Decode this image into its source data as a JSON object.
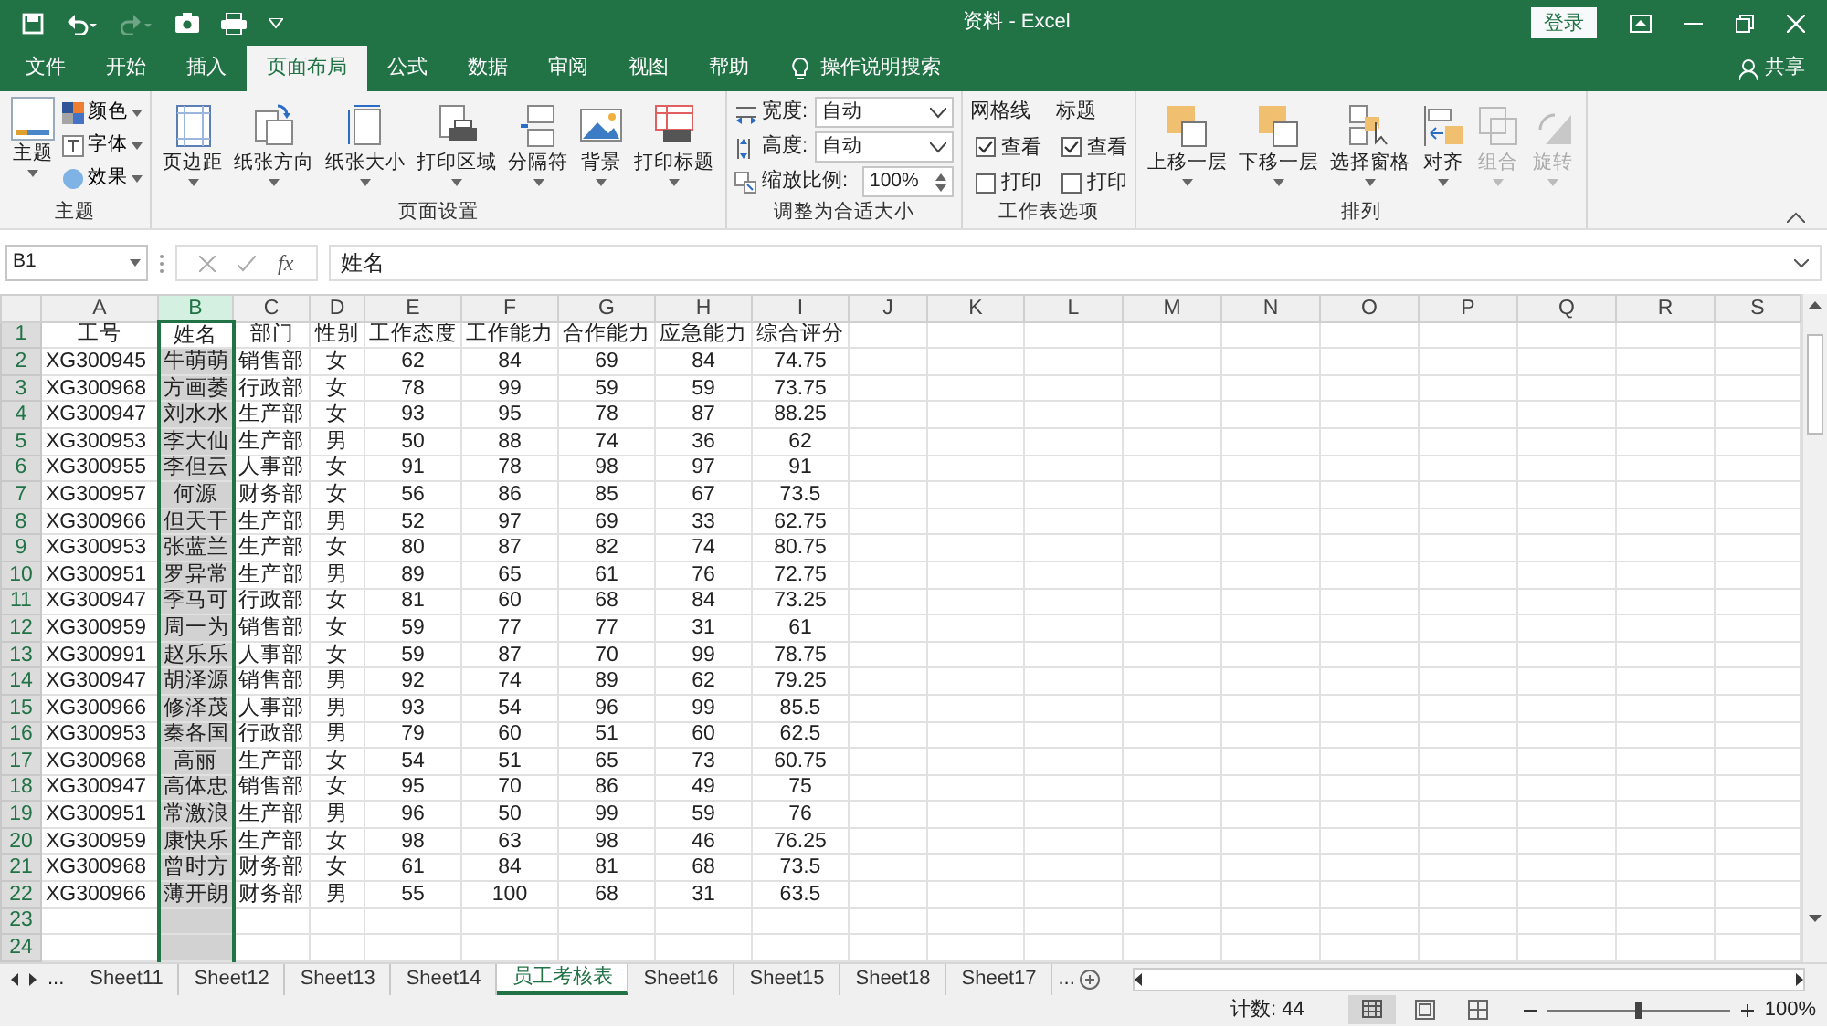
{
  "window": {
    "title": "资料 - Excel"
  },
  "sign_in": "登录",
  "share": "共享",
  "tabs": [
    {
      "label": "文件",
      "selected": false
    },
    {
      "label": "开始",
      "selected": false
    },
    {
      "label": "插入",
      "selected": false
    },
    {
      "label": "页面布局",
      "selected": true
    },
    {
      "label": "公式",
      "selected": false
    },
    {
      "label": "数据",
      "selected": false
    },
    {
      "label": "审阅",
      "selected": false
    },
    {
      "label": "视图",
      "selected": false
    },
    {
      "label": "帮助",
      "selected": false
    }
  ],
  "search": "操作说明搜索",
  "ribbon": {
    "theme": {
      "title": "主题",
      "button": "主题",
      "items": [
        "颜色",
        "字体",
        "效果"
      ]
    },
    "page_setup": {
      "title": "页面设置",
      "buttons": [
        "页边距",
        "纸张方向",
        "纸张大小",
        "打印区域",
        "分隔符",
        "背景",
        "打印标题"
      ]
    },
    "scale_to_fit": {
      "title": "调整为合适大小",
      "fields": [
        {
          "label": "宽度:",
          "value": "自动"
        },
        {
          "label": "高度:",
          "value": "自动"
        },
        {
          "label": "缩放比例:",
          "value": "100%"
        }
      ]
    },
    "sheet_options": {
      "title": "工作表选项",
      "columns": [
        {
          "heading": "网格线",
          "options": [
            {
              "label": "查看",
              "checked": true
            },
            {
              "label": "打印",
              "checked": false
            }
          ]
        },
        {
          "heading": "标题",
          "options": [
            {
              "label": "查看",
              "checked": true
            },
            {
              "label": "打印",
              "checked": false
            }
          ]
        }
      ]
    },
    "arrange": {
      "title": "排列",
      "buttons": [
        {
          "label": "上移一层",
          "disabled": false
        },
        {
          "label": "下移一层",
          "disabled": false
        },
        {
          "label": "选择窗格",
          "disabled": false
        },
        {
          "label": "对齐",
          "disabled": false
        },
        {
          "label": "组合",
          "disabled": true
        },
        {
          "label": "旋转",
          "disabled": true
        }
      ]
    }
  },
  "name_box": "B1",
  "function_button": "fx",
  "formula": "姓名",
  "sheet": {
    "columns": [
      {
        "letter": "A",
        "selected": false
      },
      {
        "letter": "B",
        "selected": true
      },
      {
        "letter": "C",
        "selected": false
      },
      {
        "letter": "D",
        "selected": false
      },
      {
        "letter": "E",
        "selected": false
      },
      {
        "letter": "F",
        "selected": false
      },
      {
        "letter": "G",
        "selected": false
      },
      {
        "letter": "H",
        "selected": false
      },
      {
        "letter": "I",
        "selected": false
      },
      {
        "letter": "J",
        "selected": false
      },
      {
        "letter": "K",
        "selected": false
      },
      {
        "letter": "L",
        "selected": false
      },
      {
        "letter": "M",
        "selected": false
      },
      {
        "letter": "N",
        "selected": false
      },
      {
        "letter": "O",
        "selected": false
      },
      {
        "letter": "P",
        "selected": false
      },
      {
        "letter": "Q",
        "selected": false
      },
      {
        "letter": "R",
        "selected": false
      },
      {
        "letter": "S",
        "selected": false
      }
    ],
    "rows": [
      {
        "number": "1",
        "cells": [
          "工号",
          "姓名",
          "部门",
          "性别",
          "工作态度",
          "工作能力",
          "合作能力",
          "应急能力",
          "综合评分"
        ]
      },
      {
        "number": "2",
        "cells": [
          "XG300945",
          "牛萌萌",
          "销售部",
          "女",
          "62",
          "84",
          "69",
          "84",
          "74.75"
        ]
      },
      {
        "number": "3",
        "cells": [
          "XG300968",
          "方画萎",
          "行政部",
          "女",
          "78",
          "99",
          "59",
          "59",
          "73.75"
        ]
      },
      {
        "number": "4",
        "cells": [
          "XG300947",
          "刘水水",
          "生产部",
          "女",
          "93",
          "95",
          "78",
          "87",
          "88.25"
        ]
      },
      {
        "number": "5",
        "cells": [
          "XG300953",
          "李大仙",
          "生产部",
          "男",
          "50",
          "88",
          "74",
          "36",
          "62"
        ]
      },
      {
        "number": "6",
        "cells": [
          "XG300955",
          "李但云",
          "人事部",
          "女",
          "91",
          "78",
          "98",
          "97",
          "91"
        ]
      },
      {
        "number": "7",
        "cells": [
          "XG300957",
          "何源",
          "财务部",
          "女",
          "56",
          "86",
          "85",
          "67",
          "73.5"
        ]
      },
      {
        "number": "8",
        "cells": [
          "XG300966",
          "但天干",
          "生产部",
          "男",
          "52",
          "97",
          "69",
          "33",
          "62.75"
        ]
      },
      {
        "number": "9",
        "cells": [
          "XG300953",
          "张蓝兰",
          "生产部",
          "女",
          "80",
          "87",
          "82",
          "74",
          "80.75"
        ]
      },
      {
        "number": "10",
        "cells": [
          "XG300951",
          "罗异常",
          "生产部",
          "男",
          "89",
          "65",
          "61",
          "76",
          "72.75"
        ]
      },
      {
        "number": "11",
        "cells": [
          "XG300947",
          "季马可",
          "行政部",
          "女",
          "81",
          "60",
          "68",
          "84",
          "73.25"
        ]
      },
      {
        "number": "12",
        "cells": [
          "XG300959",
          "周一为",
          "销售部",
          "女",
          "59",
          "77",
          "77",
          "31",
          "61"
        ]
      },
      {
        "number": "13",
        "cells": [
          "XG300991",
          "赵乐乐",
          "人事部",
          "女",
          "59",
          "87",
          "70",
          "99",
          "78.75"
        ]
      },
      {
        "number": "14",
        "cells": [
          "XG300947",
          "胡泽源",
          "销售部",
          "男",
          "92",
          "74",
          "89",
          "62",
          "79.25"
        ]
      },
      {
        "number": "15",
        "cells": [
          "XG300966",
          "修泽茂",
          "人事部",
          "男",
          "93",
          "54",
          "96",
          "99",
          "85.5"
        ]
      },
      {
        "number": "16",
        "cells": [
          "XG300953",
          "秦各国",
          "行政部",
          "男",
          "79",
          "60",
          "51",
          "60",
          "62.5"
        ]
      },
      {
        "number": "17",
        "cells": [
          "XG300968",
          "高丽",
          "生产部",
          "女",
          "54",
          "51",
          "65",
          "73",
          "60.75"
        ]
      },
      {
        "number": "18",
        "cells": [
          "XG300947",
          "高体忠",
          "销售部",
          "女",
          "95",
          "70",
          "86",
          "49",
          "75"
        ]
      },
      {
        "number": "19",
        "cells": [
          "XG300951",
          "常激浪",
          "生产部",
          "男",
          "96",
          "50",
          "99",
          "59",
          "76"
        ]
      },
      {
        "number": "20",
        "cells": [
          "XG300959",
          "康快乐",
          "生产部",
          "女",
          "98",
          "63",
          "98",
          "46",
          "76.25"
        ]
      },
      {
        "number": "21",
        "cells": [
          "XG300968",
          "曾时方",
          "财务部",
          "女",
          "61",
          "84",
          "81",
          "68",
          "73.5"
        ]
      },
      {
        "number": "22",
        "cells": [
          "XG300966",
          "薄开朗",
          "财务部",
          "男",
          "55",
          "100",
          "68",
          "31",
          "63.5"
        ]
      },
      {
        "number": "23"
      },
      {
        "number": "24"
      }
    ]
  },
  "sheet_tabs": {
    "more_left": "...",
    "tabs": [
      {
        "label": "Sheet11",
        "selected": false
      },
      {
        "label": "Sheet12",
        "selected": false
      },
      {
        "label": "Sheet13",
        "selected": false
      },
      {
        "label": "Sheet14",
        "selected": false
      },
      {
        "label": "员工考核表",
        "selected": true
      },
      {
        "label": "Sheet16",
        "selected": false
      },
      {
        "label": "Sheet15",
        "selected": false
      },
      {
        "label": "Sheet18",
        "selected": false
      },
      {
        "label": "Sheet17",
        "selected": false
      }
    ],
    "more_right": "..."
  },
  "status_bar": {
    "count": "计数: 44",
    "zoom": {
      "level": 0.5,
      "reading": "100%"
    }
  }
}
